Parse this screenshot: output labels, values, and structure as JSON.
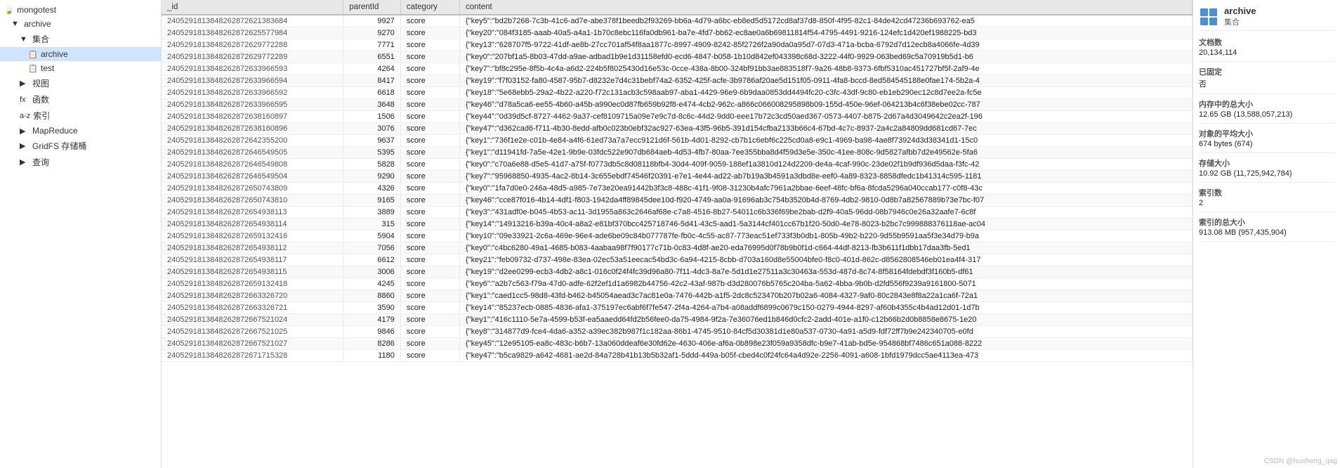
{
  "sidebar": {
    "items": [
      {
        "id": "mongotest",
        "label": "mongotest",
        "icon": "🍃",
        "indent": 0,
        "type": "db"
      },
      {
        "id": "archive-db",
        "label": "archive",
        "icon": "📁",
        "indent": 1,
        "type": "collection-group"
      },
      {
        "id": "jijie",
        "label": "集合",
        "icon": "▼",
        "indent": 2,
        "type": "section"
      },
      {
        "id": "archive-col",
        "label": "archive",
        "icon": "📋",
        "indent": 3,
        "type": "collection",
        "selected": true
      },
      {
        "id": "test-col",
        "label": "test",
        "icon": "📋",
        "indent": 3,
        "type": "collection"
      },
      {
        "id": "shitu",
        "label": "视图",
        "icon": "▶",
        "indent": 2,
        "type": "section"
      },
      {
        "id": "hanshu",
        "label": "函数",
        "icon": "▶",
        "indent": 2,
        "type": "section",
        "prefix": "fx"
      },
      {
        "id": "suoyin",
        "label": "索引",
        "icon": "▶",
        "indent": 2,
        "type": "section",
        "prefix": "a-z"
      },
      {
        "id": "mapreduce",
        "label": "MapReduce",
        "icon": "▶",
        "indent": 2,
        "type": "section"
      },
      {
        "id": "gridfs",
        "label": "GridFS 存储桶",
        "icon": "▶",
        "indent": 2,
        "type": "section"
      },
      {
        "id": "chaxun",
        "label": "查询",
        "icon": "▶",
        "indent": 2,
        "type": "section"
      }
    ]
  },
  "table": {
    "columns": [
      "_id",
      "parentId",
      "category",
      "content"
    ],
    "rows": [
      {
        "_id": "2405291813848262872621383684",
        "parentId": "9927",
        "category": "score",
        "content": "{\"key5\":\"bd2b7268-7c3b-41c6-ad7e-abe378f1beedb2f93269-bb6a-4d79-a6bc-eb8ed5d5172cd8af37d8-850f-4f95-82c1-84de42cd47236b693762-ea5"
      },
      {
        "_id": "2405291813848262872625577984",
        "parentId": "9270",
        "category": "score",
        "content": "{\"key20\":\"084f3185-aaab-40a5-a4a1-1b70c8ebc116fa0db961-ba7e-4fd7-bb62-ec8ae0a6b69811814f54-4795-4491-9216-124efc1d420ef1988225-bd3"
      },
      {
        "_id": "2405291813848262872629772288",
        "parentId": "7771",
        "category": "score",
        "content": "{\"key13\":\"628707f5-9722-41df-ae8b-27cc701af54f8aa1877c-8997-4909-8242-85f2726f2a90da0a95d7-07d3-471a-bcba-6792d7d12ecb8a4066fe-4d39"
      },
      {
        "_id": "2405291813848262872629772289",
        "parentId": "6551",
        "category": "score",
        "content": "{\"key0\":\"207bf1a5-8b03-47dd-a9ae-adbad1b9e1d31158efd0-ecd6-4847-b058-1b10d842ef043398c68d-3222-44f0-9929-063bed69c5a70919b5d1-b6"
      },
      {
        "_id": "2405291813848262872633966593",
        "parentId": "4264",
        "category": "score",
        "content": "{\"key7\":\"bf8c295e-8f5b-4c4a-a6d2-224b5f8025430d16e53c-0cce-438a-8b00-324bf91bb3ae883518f7-9a26-48b8-9373-6fbf5310ac451727bf5f-2af9-4e"
      },
      {
        "_id": "2405291813848262872633966594",
        "parentId": "8417",
        "category": "score",
        "content": "{\"key19\":\"f7f03152-fa80-4587-95b7-d8232e7d4c31bebf74a2-6352-425f-acfe-3b9786af20ae5d151f05-0911-4fa8-bccd-8ed584545188e0fae174-5b2a-4"
      },
      {
        "_id": "2405291813848262872633966592",
        "parentId": "6618",
        "category": "score",
        "content": "{\"key18\":\"5e68ebb5-29a2-4b22-a220-f72c131acb3c598aab97-aba1-4429-96e9-6b9daa0853dd4494fc20-c3fc-43df-9c80-eb1eb290ec12c8d7ee2a-fc5e"
      },
      {
        "_id": "2405291813848262872633966595",
        "parentId": "3648",
        "category": "score",
        "content": "{\"key46\":\"d78a5ca6-ee55-4b60-a45b-a990ec0d87fb659b92f8-e474-4cb2-962c-a866c066008295898b09-155d-450e-96ef-064213b4c6f38ebe02cc-787"
      },
      {
        "_id": "2405291813848262872638160897",
        "parentId": "1506",
        "category": "score",
        "content": "{\"key44\":\"0d39d5cf-8727-4462-9a37-cef8109715a09e7e9c7d-8c6c-44d2-9dd0-eee17b72c3cd50aed367-0573-4407-b875-2d67a4d3049642c2ea2f-196"
      },
      {
        "_id": "2405291813848262872638160896",
        "parentId": "3076",
        "category": "score",
        "content": "{\"key47\":\"d362cad6-f711-4b30-8edd-afb0c023b0ebf32ac927-63ea-43f5-96b5-391d154cfba2133b66c4-67bd-4c7c-8937-2a4c2a84809dd681cd67-7ec"
      },
      {
        "_id": "2405291813848262872642355200",
        "parentId": "9637",
        "category": "score",
        "content": "{\"key1\":\"736f1e2e-c01b-4e84-a4f6-61ed73a7a7ecc9121d6f-561b-4d01-8292-cb7b1c6ebf6c225cd0a8-e9c1-4969-ba98-4ae8f73924d3d38341d1-15c0"
      },
      {
        "_id": "2405291813848262872646549505",
        "parentId": "5395",
        "category": "score",
        "content": "{\"key1\":\"d11941fd-7a5e-42e1-9b9e-03fdc522e907db684aeb-4d53-4fb7-80aa-7ee355bba8d4f59d3e5e-350c-41ee-808c-9d5827afbb7d2e49562e-5fa6"
      },
      {
        "_id": "2405291813848262872646549808",
        "parentId": "5828",
        "category": "score",
        "content": "{\"key0\":\"c70a6e88-d5e5-41d7-a75f-f0773db5c8d08118bfb4-30d4-409f-9059-188ef1a3810d124d2209-de4a-4caf-990c-23de02f1b9df936d5daa-f3fc-42"
      },
      {
        "_id": "2405291813848262872646549504",
        "parentId": "9290",
        "category": "score",
        "content": "{\"key7\":\"95968850-4935-4ac2-8b14-3c655ebdf74546f20391-e7e1-4e44-ad22-ab7b19a3b4591a3dbd8e-eef0-4a89-8323-8858dfedc1b41314c595-1181"
      },
      {
        "_id": "2405291813848262872650743809",
        "parentId": "4326",
        "category": "score",
        "content": "{\"key0\":\"1fa7d0e0-246a-48d5-a985-7e73e20ea91442b3f3c8-488c-41f1-9f08-31230b4afc7961a2bbae-6eef-48fc-bf6a-8fcda5296a040ccab177-c0f8-43c"
      },
      {
        "_id": "2405291813848262872650743810",
        "parentId": "9165",
        "category": "score",
        "content": "{\"key46\":\"cce87f016-4b14-4df1-f803-1942da4ff89845dee10d-f920-4749-aa0a-91696ab3c754b3520b4d-8769-4db2-9810-0d8b7a82567889b73e7bc-f07"
      },
      {
        "_id": "2405291813848262872654938113",
        "parentId": "3889",
        "category": "score",
        "content": "{\"key3\":\"431adf0e-b045-4b53-ac11-3d1955a863c2646af68e-c7a8-4516-8b27-54011c6b336f69be2bab-d2f9-40a5-96dd-08b7946c0e26a32aafe7-6c8f"
      },
      {
        "_id": "2405291813848262872654938114",
        "parentId": "315",
        "category": "score",
        "content": "{\"key14\":\"14913216-b39a-40c4-a8a2-e81bf370bcc425718746-5d41-43c5-aad1-5a3144cf401cc67b1f20-50d0-4e78-8023-b2bc7c999888376118ae-ac04"
      },
      {
        "_id": "2405291813848262872659132416",
        "parentId": "5904",
        "category": "score",
        "content": "{\"key10\":\"09e33921-2c6a-469e-96e4-ade6be09c84b077787fe-fb0c-4c55-ac87-773eac51ef733f3b0db1-805b-49b2-b220-9d55b9591aa5f3e34d79-b9a"
      },
      {
        "_id": "2405291813848262872654938112",
        "parentId": "7056",
        "category": "score",
        "content": "{\"key0\":\"c4bc6280-49a1-4685-b083-4aabaa98f7f90177c71b-0c83-4d8f-ae20-eda76995d0f78b9b0f1d-c664-44df-8213-fb3b611f1dbb17daa3fb-5ed1"
      },
      {
        "_id": "2405291813848262872654938117",
        "parentId": "6612",
        "category": "score",
        "content": "{\"key21\":\"feb09732-d737-498e-83ea-02ec53a51eecac54bd3c-6a94-4215-8cbb-d703a160d8e55004bfe0-f8c0-401d-862c-d8562808546eb01ea4f4-317"
      },
      {
        "_id": "2405291813848262872654938115",
        "parentId": "3006",
        "category": "score",
        "content": "{\"key19\":\"d2ee0299-ecb3-4db2-a8c1-016c0f24f4fc39d96a80-7f11-4dc3-8a7e-5d1d1e27511a3c30463a-553d-487d-8c74-8f58164fdebdf3f160b5-df61"
      },
      {
        "_id": "2405291813848262872659132418",
        "parentId": "4245",
        "category": "score",
        "content": "{\"key6\":\"a2b7c563-f79a-47d0-adfe-62f2ef1d1a6982b44756-42c2-43af-987b-d3d280076b5765c204ba-5a62-4bba-9b0b-d2fd556f9239a9161800-5071"
      },
      {
        "_id": "2405291813848262872663326720",
        "parentId": "8860",
        "category": "score",
        "content": "{\"key1\":\"caed1cc5-98d8-43fd-b462-b45054aead3c7ac81e0a-7476-442b-a1f5-2dc8c523470b207b02a6-4084-4327-9af0-80c2843e8f8a22a1ca6f-72a1"
      },
      {
        "_id": "2405291813848262872663326721",
        "parentId": "3590",
        "category": "score",
        "content": "{\"key14\":\"85237ecb-0885-4836-afa1-375197ec6abf6f7fe547-2f4a-4264-a7b4-a08addf6899c0679c150-0279-4944-8297-af60b4355c4b4ad12d01-1d7b"
      },
      {
        "_id": "2405291813848262872667521024",
        "parentId": "4179",
        "category": "score",
        "content": "{\"key1\":\"416c1110-5e7a-4599-b53f-ea5aaedd64fd2b56fee0-da75-4984-9f2a-7e36076ed1b846d0cfc2-2add-401e-a1f0-c12b66b2d0b8858e8675-1e20"
      },
      {
        "_id": "2405291813848262872667521025",
        "parentId": "9846",
        "category": "score",
        "content": "{\"key8\":\"314877d9-fce4-4da6-a352-a39ec382b987f1c182aa-86b1-4745-9510-84cf5d30381d1e80a537-0730-4a91-a5d9-fdf72ff7b9e242340705-e0fd"
      },
      {
        "_id": "2405291813848262872667521027",
        "parentId": "8286",
        "category": "score",
        "content": "{\"key45\":\"12e95105-ea8c-483c-b6b7-13a060ddeaf6e30fd62e-4630-406e-af6a-0b898e23f059a9358dfc-b9e7-41ab-bd5e-954868bf7486c651a088-8222"
      },
      {
        "_id": "2405291813848262872671715328",
        "parentId": "1180",
        "category": "score",
        "content": "{\"key47\":\"b5ca9829-a642-4681-ae2d-84a728b41b13b5b32af1-5ddd-449a-b05f-cbed4c0f24fc64a4d92e-2256-4091-a608-1bfd1979dcc5ae4113ea-473"
      }
    ]
  },
  "right_panel": {
    "title": "archive",
    "subtitle": "集合",
    "grid_label": "集合",
    "fields": [
      {
        "label": "文档数",
        "value": "20,134,114"
      },
      {
        "label": "已固定",
        "value": "否"
      },
      {
        "label": "内存中的总大小",
        "value": "12.65 GB (13,588,057,213)"
      },
      {
        "label": "对象的平均大小",
        "value": "674 bytes (674)"
      },
      {
        "label": "存储大小",
        "value": "10.92 GB (11,725,942,784)"
      },
      {
        "label": "索引数",
        "value": "2"
      },
      {
        "label": "索引的总大小",
        "value": "913.08 MB (957,435,904)"
      }
    ]
  },
  "watermark": "CSDN @huisheng_qag"
}
